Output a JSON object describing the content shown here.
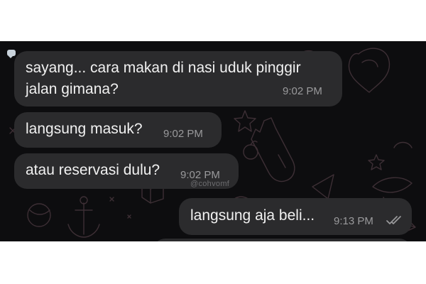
{
  "messages": [
    {
      "text_line1": "sayang... cara makan di nasi uduk pinggir",
      "text_line2": "jalan gimana?",
      "time": "9:02 PM",
      "direction": "incoming"
    },
    {
      "text": "langsung masuk?",
      "time": "9:02 PM",
      "direction": "incoming"
    },
    {
      "text": "atau reservasi dulu?",
      "time": "9:02 PM",
      "direction": "incoming"
    },
    {
      "text": "langsung aja beli...",
      "time": "9:13 PM",
      "direction": "outgoing",
      "status_icon": "double-check-icon"
    }
  ],
  "watermark": "@cohvomf",
  "colors": {
    "chat_background": "#0d0d0f",
    "bubble": "#2b2b2d",
    "text": "#f1f1f1",
    "timestamp": "#9a9a9c",
    "doodle": "#3d2f35"
  }
}
